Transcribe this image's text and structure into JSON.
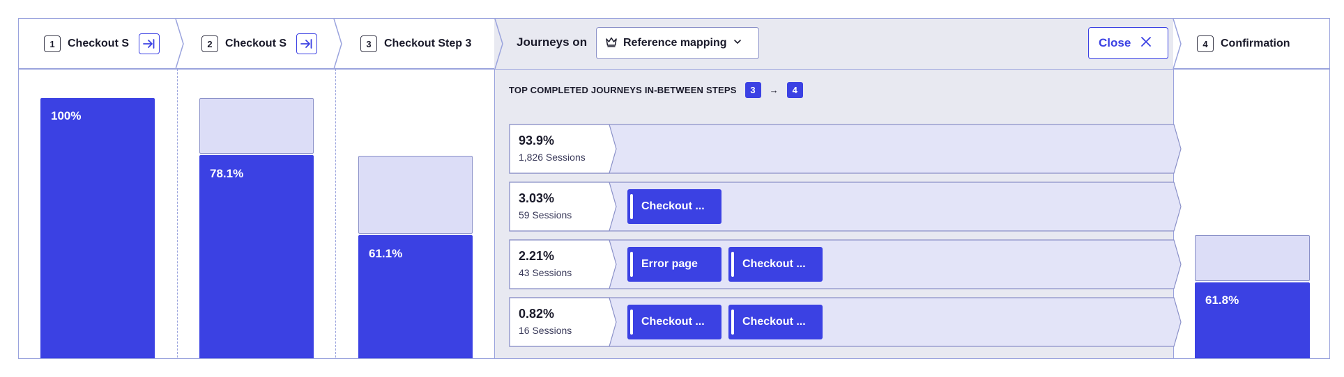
{
  "steps": [
    {
      "num": "1",
      "label": "Checkout S",
      "pct": "100%"
    },
    {
      "num": "2",
      "label": "Checkout S",
      "pct": "78.1%"
    },
    {
      "num": "3",
      "label": "Checkout Step 3",
      "pct": "61.1%"
    },
    {
      "num": "4",
      "label": "Confirmation",
      "pct": "61.8%"
    }
  ],
  "journeys_panel": {
    "title": "Journeys on",
    "reference_button": "Reference mapping",
    "close_button": "Close",
    "top_title": "TOP COMPLETED JOURNEYS IN-BETWEEN STEPS",
    "from_step": "3",
    "to_step": "4",
    "arrow": "→",
    "rows": [
      {
        "pct": "93.9%",
        "sessions": "1,826 Sessions",
        "chips": []
      },
      {
        "pct": "3.03%",
        "sessions": "59 Sessions",
        "chips": [
          "Checkout ..."
        ]
      },
      {
        "pct": "2.21%",
        "sessions": "43 Sessions",
        "chips": [
          "Error page",
          "Checkout ..."
        ]
      },
      {
        "pct": "0.82%",
        "sessions": "16 Sessions",
        "chips": [
          "Checkout ...",
          "Checkout ..."
        ]
      }
    ]
  },
  "icons": {
    "goto": "arrow-to-line-icon",
    "crown": "crown-icon",
    "chevron_down": "chevron-down-icon",
    "close": "close-icon"
  },
  "colors": {
    "accent": "#3b41e3",
    "ghost_bar": "#dcddf7",
    "border": "#9aa3dd",
    "panel_bg": "#e8e9f1",
    "row_bg": "#e3e4f8"
  }
}
